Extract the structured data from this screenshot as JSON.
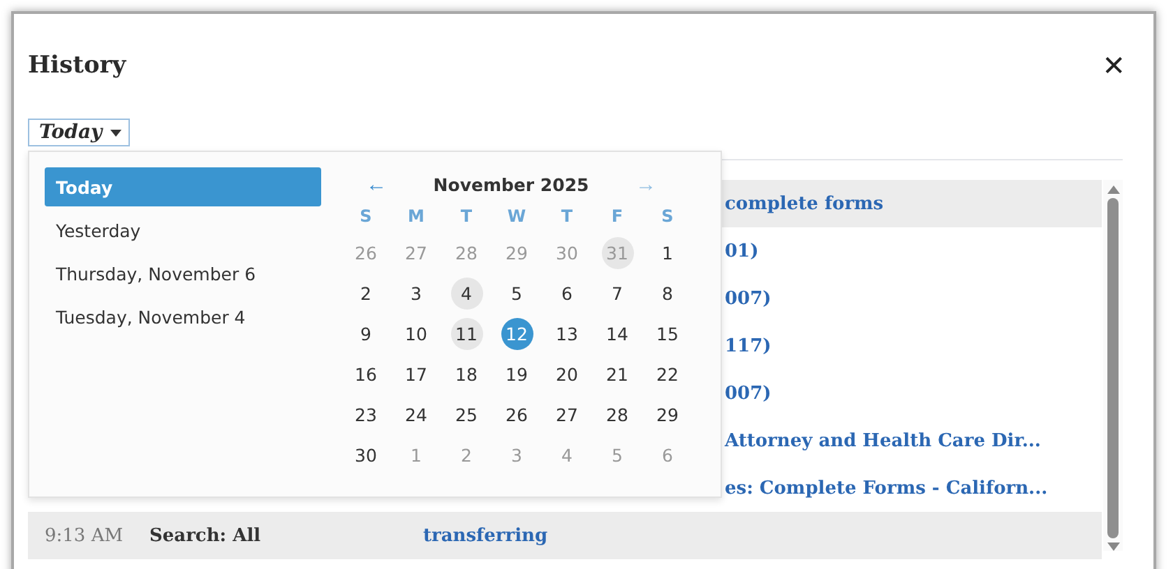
{
  "window": {
    "title": "History",
    "close": "✕"
  },
  "filter": {
    "value": "Today"
  },
  "history": [
    {
      "link": "complete forms",
      "shaded": true
    },
    {
      "link": "01)",
      "shaded": false
    },
    {
      "link": "007)",
      "shaded": false
    },
    {
      "link": "117)",
      "shaded": false
    },
    {
      "link": "007)",
      "shaded": false
    },
    {
      "link": "Attorney and Health Care Dir...",
      "shaded": false
    },
    {
      "link": "es: Complete Forms - Californ...",
      "shaded": false
    },
    {
      "time": "9:13 AM",
      "search": "Search: All",
      "link": "transferring",
      "shaded": true
    }
  ],
  "presets": [
    {
      "label": "Today",
      "selected": true
    },
    {
      "label": "Yesterday",
      "selected": false
    },
    {
      "label": "Thursday, November 6",
      "selected": false
    },
    {
      "label": "Tuesday, November 4",
      "selected": false
    }
  ],
  "calendar": {
    "month": "November 2025",
    "prev": "←",
    "next": "→",
    "next_disabled": true,
    "weekdays": [
      "S",
      "M",
      "T",
      "W",
      "T",
      "F",
      "S"
    ],
    "weeks": [
      [
        {
          "d": "26",
          "muted": true,
          "marked": false,
          "selected": false
        },
        {
          "d": "27",
          "muted": true,
          "marked": false,
          "selected": false
        },
        {
          "d": "28",
          "muted": true,
          "marked": false,
          "selected": false
        },
        {
          "d": "29",
          "muted": true,
          "marked": false,
          "selected": false
        },
        {
          "d": "30",
          "muted": true,
          "marked": false,
          "selected": false
        },
        {
          "d": "31",
          "muted": true,
          "marked": true,
          "selected": false
        },
        {
          "d": "1",
          "muted": false,
          "marked": false,
          "selected": false
        }
      ],
      [
        {
          "d": "2",
          "muted": false,
          "marked": false,
          "selected": false
        },
        {
          "d": "3",
          "muted": false,
          "marked": false,
          "selected": false
        },
        {
          "d": "4",
          "muted": false,
          "marked": true,
          "selected": false
        },
        {
          "d": "5",
          "muted": false,
          "marked": false,
          "selected": false
        },
        {
          "d": "6",
          "muted": false,
          "marked": false,
          "selected": false
        },
        {
          "d": "7",
          "muted": false,
          "marked": false,
          "selected": false
        },
        {
          "d": "8",
          "muted": false,
          "marked": false,
          "selected": false
        }
      ],
      [
        {
          "d": "9",
          "muted": false,
          "marked": false,
          "selected": false
        },
        {
          "d": "10",
          "muted": false,
          "marked": false,
          "selected": false
        },
        {
          "d": "11",
          "muted": false,
          "marked": true,
          "selected": false
        },
        {
          "d": "12",
          "muted": false,
          "marked": false,
          "selected": true
        },
        {
          "d": "13",
          "muted": false,
          "marked": false,
          "selected": false
        },
        {
          "d": "14",
          "muted": false,
          "marked": false,
          "selected": false
        },
        {
          "d": "15",
          "muted": false,
          "marked": false,
          "selected": false
        }
      ],
      [
        {
          "d": "16",
          "muted": false,
          "marked": false,
          "selected": false
        },
        {
          "d": "17",
          "muted": false,
          "marked": false,
          "selected": false
        },
        {
          "d": "18",
          "muted": false,
          "marked": false,
          "selected": false
        },
        {
          "d": "19",
          "muted": false,
          "marked": false,
          "selected": false
        },
        {
          "d": "20",
          "muted": false,
          "marked": false,
          "selected": false
        },
        {
          "d": "21",
          "muted": false,
          "marked": false,
          "selected": false
        },
        {
          "d": "22",
          "muted": false,
          "marked": false,
          "selected": false
        }
      ],
      [
        {
          "d": "23",
          "muted": false,
          "marked": false,
          "selected": false
        },
        {
          "d": "24",
          "muted": false,
          "marked": false,
          "selected": false
        },
        {
          "d": "25",
          "muted": false,
          "marked": false,
          "selected": false
        },
        {
          "d": "26",
          "muted": false,
          "marked": false,
          "selected": false
        },
        {
          "d": "27",
          "muted": false,
          "marked": false,
          "selected": false
        },
        {
          "d": "28",
          "muted": false,
          "marked": false,
          "selected": false
        },
        {
          "d": "29",
          "muted": false,
          "marked": false,
          "selected": false
        }
      ],
      [
        {
          "d": "30",
          "muted": false,
          "marked": false,
          "selected": false
        },
        {
          "d": "1",
          "muted": true,
          "marked": false,
          "selected": false
        },
        {
          "d": "2",
          "muted": true,
          "marked": false,
          "selected": false
        },
        {
          "d": "3",
          "muted": true,
          "marked": false,
          "selected": false
        },
        {
          "d": "4",
          "muted": true,
          "marked": false,
          "selected": false
        },
        {
          "d": "5",
          "muted": true,
          "marked": false,
          "selected": false
        },
        {
          "d": "6",
          "muted": true,
          "marked": false,
          "selected": false
        }
      ]
    ]
  }
}
